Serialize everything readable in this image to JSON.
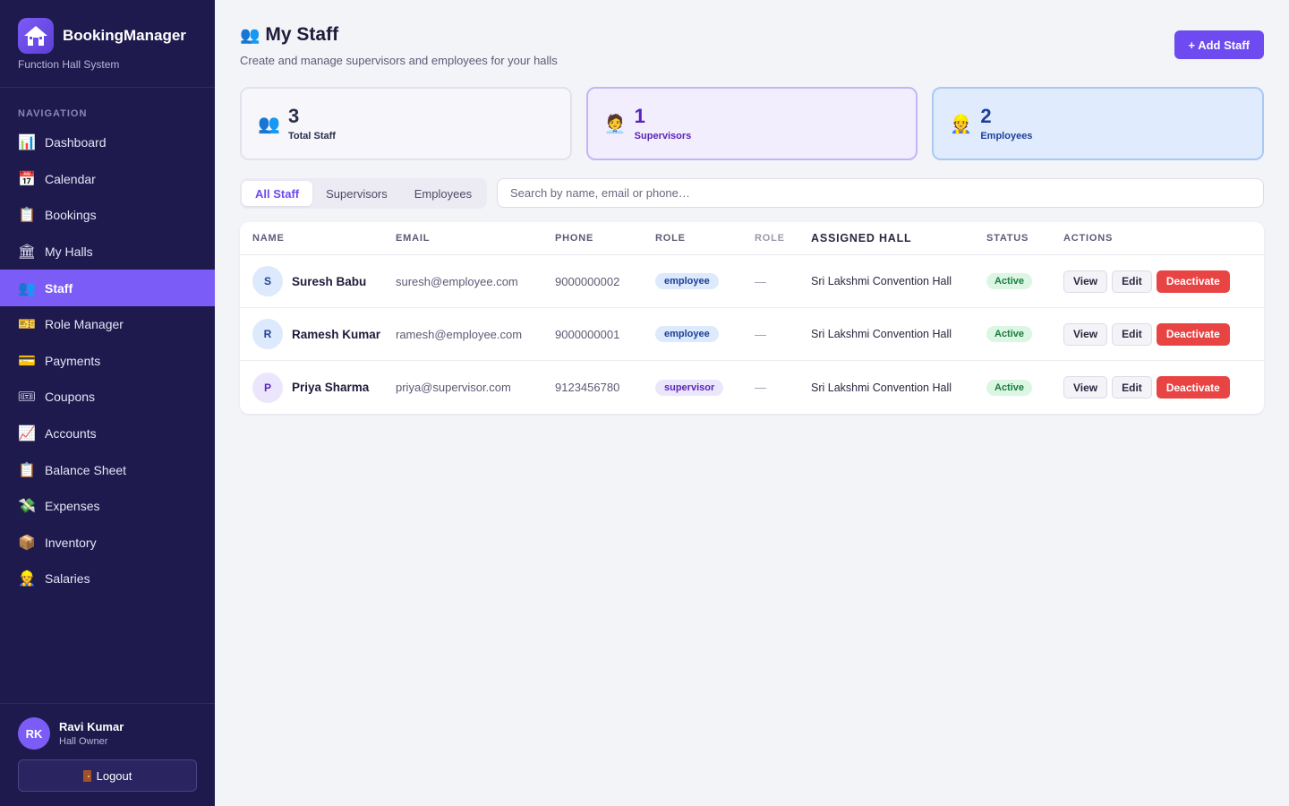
{
  "brand": {
    "title": "BookingManager",
    "subtitle": "Function Hall System"
  },
  "nav": {
    "heading": "NAVIGATION",
    "items": [
      {
        "label": "Dashboard",
        "icon": "📊",
        "icon_name": "bar-chart-icon"
      },
      {
        "label": "Calendar",
        "icon": "📅",
        "icon_name": "calendar-icon"
      },
      {
        "label": "Bookings",
        "icon": "📋",
        "icon_name": "clipboard-icon"
      },
      {
        "label": "My Halls",
        "icon": "🏛",
        "icon_name": "building-icon"
      },
      {
        "label": "Staff",
        "icon": "👥",
        "icon_name": "people-icon",
        "active": true
      },
      {
        "label": "Role Manager",
        "icon": "🎫",
        "icon_name": "ticket-icon"
      },
      {
        "label": "Payments",
        "icon": "💳",
        "icon_name": "card-icon"
      },
      {
        "label": "Coupons",
        "icon": "🎟",
        "icon_name": "coupon-icon"
      },
      {
        "label": "Accounts",
        "icon": "📈",
        "icon_name": "trend-chart-icon"
      },
      {
        "label": "Balance Sheet",
        "icon": "📋",
        "icon_name": "clipboard-icon"
      },
      {
        "label": "Expenses",
        "icon": "💸",
        "icon_name": "money-wings-icon"
      },
      {
        "label": "Inventory",
        "icon": "📦",
        "icon_name": "package-icon"
      },
      {
        "label": "Salaries",
        "icon": "👷",
        "icon_name": "worker-icon"
      }
    ]
  },
  "user": {
    "initials": "RK",
    "name": "Ravi Kumar",
    "role": "Hall Owner",
    "logout_label": "Logout"
  },
  "header": {
    "icon": "👥",
    "title": "My Staff",
    "subtitle": "Create and manage supervisors and employees for your halls",
    "add_button": "+ Add Staff"
  },
  "stats": {
    "total": {
      "value": "3",
      "label": "Total Staff",
      "icon": "👥"
    },
    "supervisors": {
      "value": "1",
      "label": "Supervisors",
      "icon": "🧑‍💼"
    },
    "employees": {
      "value": "2",
      "label": "Employees",
      "icon": "👷"
    }
  },
  "filters": {
    "tabs": [
      "All Staff",
      "Supervisors",
      "Employees"
    ],
    "active": "All Staff"
  },
  "search": {
    "placeholder": "Search by name, email or phone…",
    "value": ""
  },
  "table": {
    "columns": [
      "NAME",
      "EMAIL",
      "PHONE",
      "ROLE",
      "ROLE",
      "ASSIGNED HALL",
      "STATUS",
      "ACTIONS"
    ],
    "rows": [
      {
        "initial": "S",
        "name": "Suresh Babu",
        "email": "suresh@employee.com",
        "phone": "9000000002",
        "role": "employee",
        "role2": "—",
        "hall": "Sri Lakshmi Convention Hall",
        "status": "Active"
      },
      {
        "initial": "R",
        "name": "Ramesh Kumar",
        "email": "ramesh@employee.com",
        "phone": "9000000001",
        "role": "employee",
        "role2": "—",
        "hall": "Sri Lakshmi Convention Hall",
        "status": "Active"
      },
      {
        "initial": "P",
        "name": "Priya Sharma",
        "email": "priya@supervisor.com",
        "phone": "9123456780",
        "role": "supervisor",
        "role2": "—",
        "hall": "Sri Lakshmi Convention Hall",
        "status": "Active"
      }
    ],
    "actions": {
      "view": "View",
      "edit": "Edit",
      "deactivate": "Deactivate"
    }
  },
  "colors": {
    "sidebar": "#1f1a4d",
    "accent": "#7c5cf6",
    "danger": "#e94444",
    "success": "#1b7a3e"
  }
}
